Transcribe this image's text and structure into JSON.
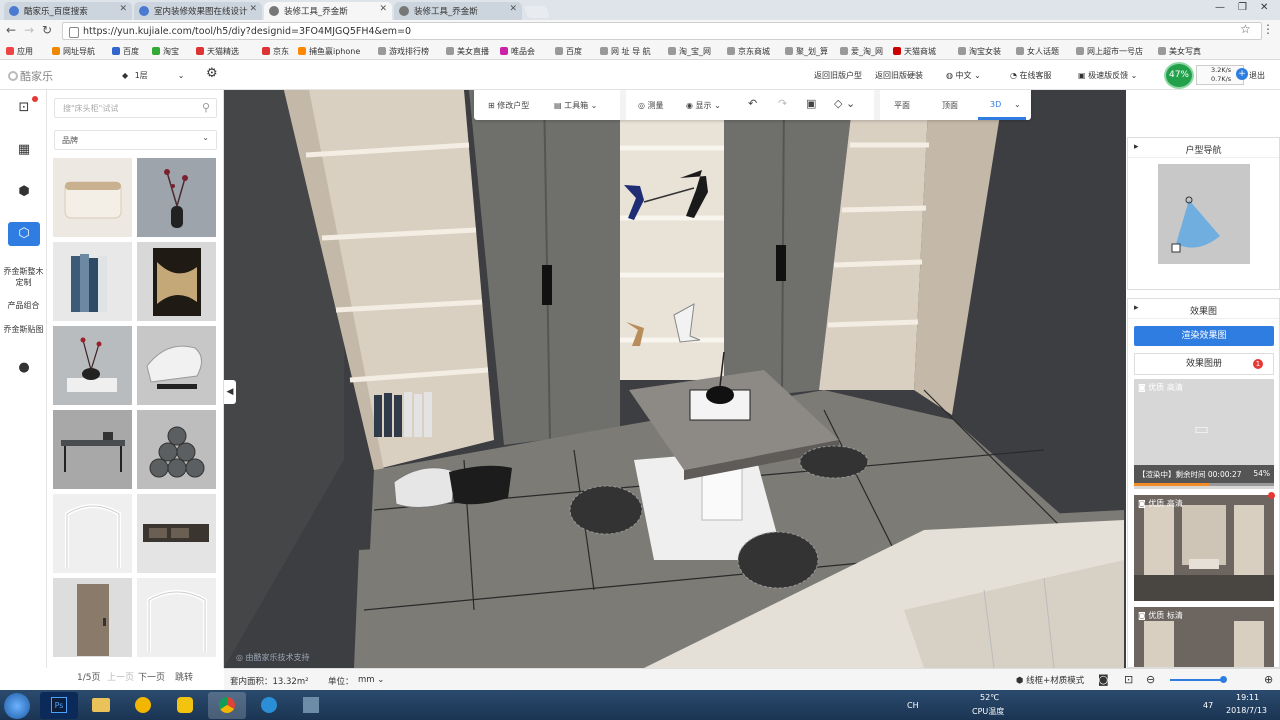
{
  "tabs": [
    {
      "label": "酷家乐_百度搜索"
    },
    {
      "label": "室内装修效果图在线设计"
    },
    {
      "label": "装修工具_乔金斯"
    },
    {
      "label": "装修工具_乔金斯"
    }
  ],
  "address": {
    "url": "https://yun.kujiale.com/tool/h5/diy?designid=3FO4MJGQ5FH4&em=0"
  },
  "bookmarks": [
    "应用",
    "网址导航",
    "百度",
    "淘宝",
    "天猫精选",
    "京东",
    "捕鱼赢iphone",
    "游戏排行榜",
    "美女直播",
    "唯品会",
    "百度",
    "网 址 导 航",
    "淘_宝_网",
    "京东商城",
    "聚_划_算",
    "爱_淘_网",
    "天猫商城",
    "淘宝女装",
    "女人话题",
    "网上超市一号店",
    "美女写真"
  ],
  "app": {
    "logo": "酷家乐",
    "floor": "1层",
    "back_old_house": "返回旧版户型",
    "back_old_decor": "返回旧版硬装",
    "language": "中文",
    "service": "在线客服",
    "feedback": "极速版反馈",
    "exit": "退出",
    "cpu_percent": "47%",
    "net_up": "3.2K/s",
    "net_down": "0.7K/s"
  },
  "left_nav": {
    "custom": "乔金斯整木定制",
    "combo": "产品组合",
    "tiles": "乔金斯贴图"
  },
  "panel": {
    "search_placeholder": "搜\"床头柜\"试试",
    "brand": "品牌",
    "pager": {
      "page": "1/5页",
      "prev": "上一页",
      "next": "下一页",
      "jump": "跳转"
    }
  },
  "viewport_toolbar": {
    "edit_house": "修改户型",
    "toolbox": "工具箱",
    "measure": "测量",
    "display": "显示",
    "plan": "平面",
    "top": "顶面",
    "view3d": "3D"
  },
  "watermark": "由酷家乐技术支持",
  "house_nav": {
    "title": "户型导航"
  },
  "render": {
    "title": "效果图",
    "render_button": "渲染效果图",
    "album": "效果图册",
    "album_badge": "1",
    "cards": [
      {
        "quality": "优质 高清",
        "progress_text": "【渲染中】剩余时间 00:00:27",
        "progress_pct": "54%",
        "progress": 0.54
      },
      {
        "quality": "优质 高清"
      },
      {
        "quality": "优质 标清"
      }
    ]
  },
  "status": {
    "area": "套内面积：13.32m²",
    "unit_label": "单位：",
    "unit": "mm",
    "mode": "线框+材质模式"
  },
  "tray": {
    "temp": "52℃",
    "cpu_temp": "CPU温度",
    "time": "19:11",
    "date": "2018/7/13",
    "lang": "CH",
    "vol": "47"
  }
}
